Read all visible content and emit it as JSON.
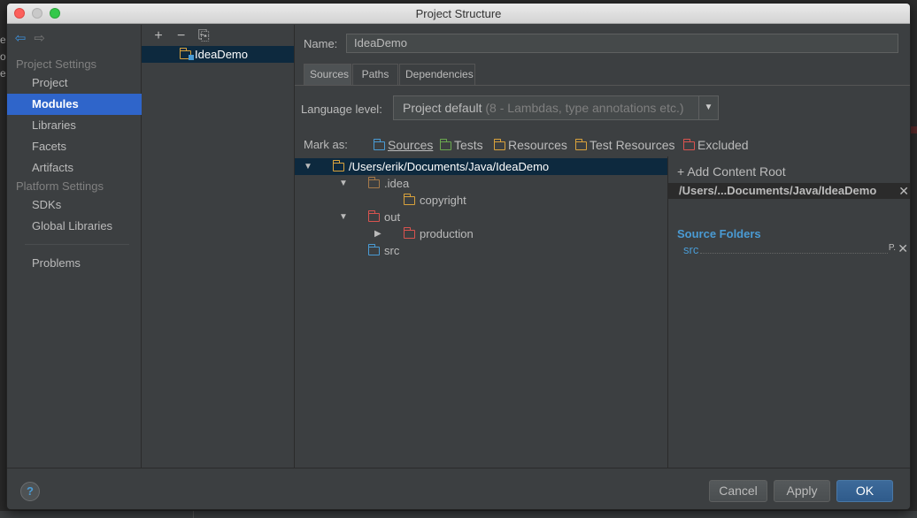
{
  "background": {
    "left_text": [
      "er",
      "on",
      "er"
    ]
  },
  "window": {
    "title": "Project Structure"
  },
  "leftnav": {
    "sections": [
      {
        "label": "Project Settings"
      },
      {
        "label": "Platform Settings"
      }
    ],
    "items": [
      {
        "label": "Project"
      },
      {
        "label": "Modules"
      },
      {
        "label": "Libraries"
      },
      {
        "label": "Facets"
      },
      {
        "label": "Artifacts"
      },
      {
        "label": "SDKs"
      },
      {
        "label": "Global Libraries"
      },
      {
        "label": "Problems"
      }
    ],
    "selected": "Modules"
  },
  "modules": {
    "toolbar": {
      "add": "+",
      "remove": "−",
      "copy": "⎘"
    },
    "items": [
      {
        "label": "IdeaDemo"
      }
    ]
  },
  "main": {
    "name_label": "Name:",
    "name_value": "IdeaDemo",
    "tabs": [
      {
        "label": "Sources"
      },
      {
        "label": "Paths"
      },
      {
        "label": "Dependencies"
      }
    ],
    "active_tab": "Sources",
    "language_level_label": "Language level:",
    "language_level_value": "Project default",
    "language_level_hint": "(8 - Lambdas, type annotations etc.)",
    "mark_as_label": "Mark as:",
    "mark_as": [
      {
        "label": "Sources",
        "color": "#4a9bd4"
      },
      {
        "label": "Tests",
        "color": "#6aa84f"
      },
      {
        "label": "Resources",
        "color": "#d9a23c"
      },
      {
        "label": "Test Resources",
        "color": "#d9a23c"
      },
      {
        "label": "Excluded",
        "color": "#d9534f"
      }
    ],
    "tree": [
      {
        "label": "/Users/erik/Documents/Java/IdeaDemo",
        "folder": "orange",
        "expanded": true
      },
      {
        "label": ".idea",
        "folder": "brown",
        "expanded": true
      },
      {
        "label": "copyright",
        "folder": "orange"
      },
      {
        "label": "out",
        "folder": "red",
        "expanded": true
      },
      {
        "label": "production",
        "folder": "red",
        "expanded": false
      },
      {
        "label": "src",
        "folder": "blue"
      }
    ],
    "right": {
      "add_content_root": "Add Content Root",
      "root_path": "/Users/...Documents/Java/IdeaDemo",
      "source_folders_heading": "Source Folders",
      "source_folders": [
        {
          "label": "src"
        }
      ]
    }
  },
  "buttons": {
    "help": "?",
    "cancel": "Cancel",
    "apply": "Apply",
    "ok": "OK"
  }
}
